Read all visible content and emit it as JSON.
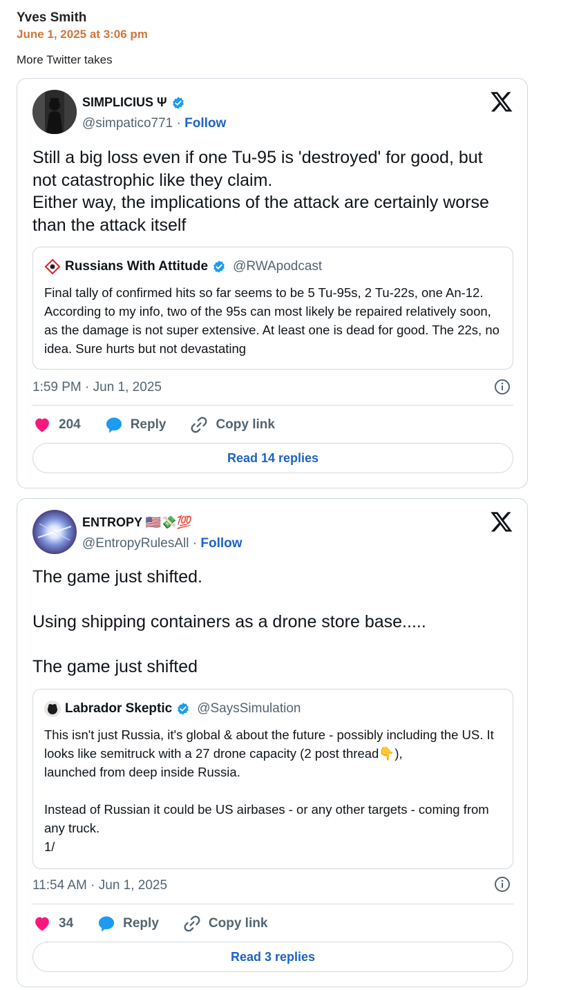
{
  "comment": {
    "author": "Yves Smith",
    "date": "June 1, 2025 at 3:06 pm",
    "text": "More Twitter takes"
  },
  "colors": {
    "accent": "#d0763c",
    "link": "#1d62c6",
    "heart": "#f91880",
    "verified": "#1d9bf0"
  },
  "tweets": [
    {
      "display_name": "SIMPLICIUS Ψ",
      "handle": "@simpatico771",
      "separator": "·",
      "follow_label": "Follow",
      "text": "Still a big loss even if one Tu-95 is 'destroyed' for good, but not catastrophic like they claim.\nEither way, the implications of the attack are certainly worse than the attack itself",
      "quote": {
        "name": "Russians With Attitude",
        "handle": "@RWApodcast",
        "text": "Final tally of confirmed hits so far seems to be 5 Tu-95s, 2 Tu-22s, one An-12. According to my info, two of the 95s can most likely be repaired relatively soon, as the damage is not super extensive. At least one is dead for good. The 22s, no idea. Sure hurts but not devastating"
      },
      "timestamp": "1:59 PM · Jun 1, 2025",
      "likes": "204",
      "reply_label": "Reply",
      "copy_label": "Copy link",
      "read_replies": "Read 14 replies"
    },
    {
      "display_name": "ENTROPY 🇺🇸💸💯",
      "handle": "@EntropyRulesAll",
      "separator": "·",
      "follow_label": "Follow",
      "text": "The game just shifted.\n\nUsing shipping containers as a drone store base.....\n\nThe game just shifted",
      "quote": {
        "name": "Labrador Skeptic",
        "handle": "@SaysSimulation",
        "text": "This isn't just Russia, it's global & about the future - possibly including the US. It looks like semitruck with a 27 drone capacity (2 post thread👇),\nlaunched from deep inside Russia.\n\nInstead of Russian it could be US airbases - or any other targets - coming from any truck.\n1/"
      },
      "timestamp": "11:54 AM · Jun 1, 2025",
      "likes": "34",
      "reply_label": "Reply",
      "copy_label": "Copy link",
      "read_replies": "Read 3 replies"
    }
  ]
}
